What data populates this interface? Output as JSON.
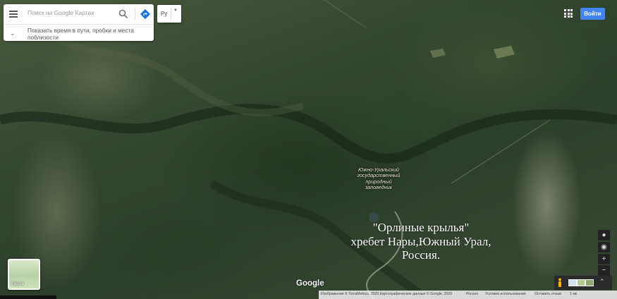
{
  "search": {
    "placeholder": "Поиск на Google Картах"
  },
  "hint": {
    "text": "Показать время в пути, пробки и места поблизости"
  },
  "language": {
    "label": "Ру"
  },
  "header": {
    "login_label": "Войти"
  },
  "map": {
    "view": "satellite",
    "place_label": "Южно-Уральский государственный природный заповедник",
    "caption_lines": [
      "\"Орлиные крылья\"",
      "хребет Нары,Южный Урал,",
      "Россия."
    ],
    "watermark": "Google"
  },
  "layer_switcher": {
    "label": "Карта"
  },
  "footer": {
    "attribution": "Изображения © TerraMetrics, 2020,Картографические данные © Google, 2020",
    "country": "Россия",
    "terms": "Условия использования",
    "feedback": "Оставить отзыв",
    "scale": "1 км"
  },
  "colors": {
    "accent": "#4285f4",
    "place_label": "#f4efd4"
  }
}
